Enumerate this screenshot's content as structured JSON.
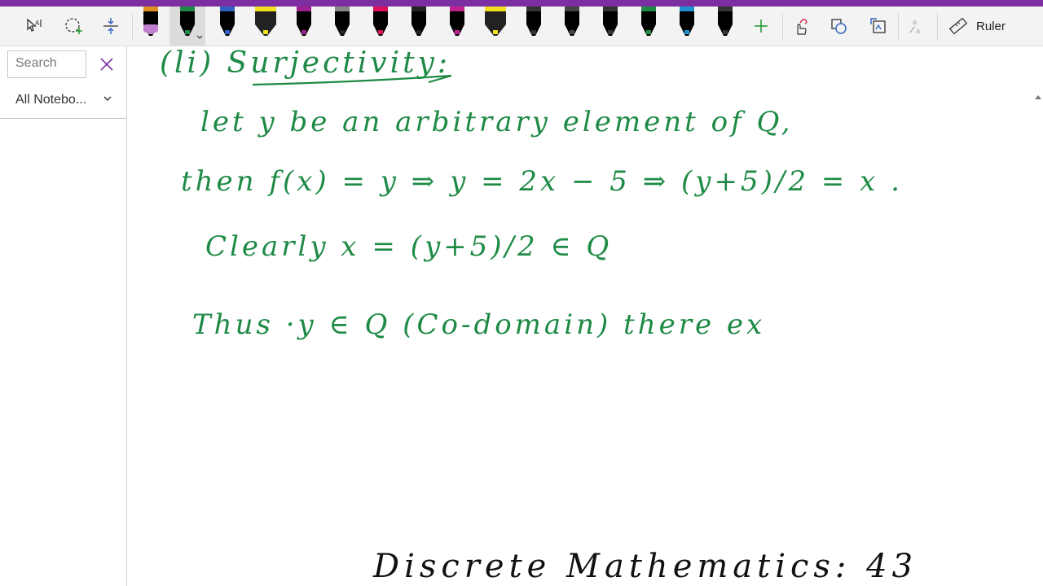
{
  "toolbar": {
    "pens": [
      {
        "icon": "pen-icon",
        "color": "#000000",
        "cap": "#e09020",
        "tip": "#c080d0"
      },
      {
        "icon": "pen-icon",
        "color": "#000000",
        "cap": "#1e8a45",
        "tip": "#1e8a45"
      },
      {
        "icon": "pen-icon",
        "color": "#000000",
        "cap": "#3060c0",
        "tip": "#3060c0"
      },
      {
        "icon": "highlighter-icon",
        "color": "#222222",
        "cap": "#f0e020",
        "tip": "#f0e020"
      },
      {
        "icon": "pen-icon",
        "color": "#000000",
        "cap": "#a02090",
        "tip": "#a02090"
      },
      {
        "icon": "pen-icon",
        "color": "#000000",
        "cap": "#888888",
        "tip": "#222222"
      },
      {
        "icon": "pen-icon",
        "color": "#000000",
        "cap": "#e01060",
        "tip": "#e01060"
      },
      {
        "icon": "pen-icon",
        "color": "#000000",
        "cap": "#222222",
        "tip": "#222222"
      },
      {
        "icon": "pen-icon",
        "color": "#000000",
        "cap": "#c02090",
        "tip": "#c02090"
      },
      {
        "icon": "highlighter-icon",
        "color": "#222222",
        "cap": "#f0e020",
        "tip": "#f0e020"
      },
      {
        "icon": "pen-icon",
        "color": "#000000",
        "cap": "#333333",
        "tip": "#333333"
      },
      {
        "icon": "pen-icon",
        "color": "#000000",
        "cap": "#444444",
        "tip": "#444444"
      },
      {
        "icon": "pen-icon",
        "color": "#000000",
        "cap": "#333333",
        "tip": "#333333"
      },
      {
        "icon": "pen-icon",
        "color": "#000000",
        "cap": "#1e8a45",
        "tip": "#1e8a45"
      },
      {
        "icon": "pen-icon",
        "color": "#000000",
        "cap": "#2090d0",
        "tip": "#2090d0"
      },
      {
        "icon": "pen-icon",
        "color": "#000000",
        "cap": "#333333",
        "tip": "#333333"
      }
    ],
    "ruler_label": "Ruler"
  },
  "sidebar": {
    "search_placeholder": "Search",
    "notebook_label": "All Notebo..."
  },
  "ink": {
    "line1": "(li) Surjectivity:",
    "line2": "let y be an arbitrary element of Q,",
    "line3": "then f(x) = y ⇒ y = 2x − 5 ⇒ (y+5)/2 = x .",
    "line4": "Clearly x = (y+5)/2 ∈ Q",
    "line5": "Thus ·y ∈ Q (Co-domain) there ex",
    "footer": "Discrete Mathematics: 43"
  },
  "colors": {
    "accent": "#7b2fa0",
    "ink_green": "#1e8a45",
    "add_green": "#2a9a3a"
  }
}
